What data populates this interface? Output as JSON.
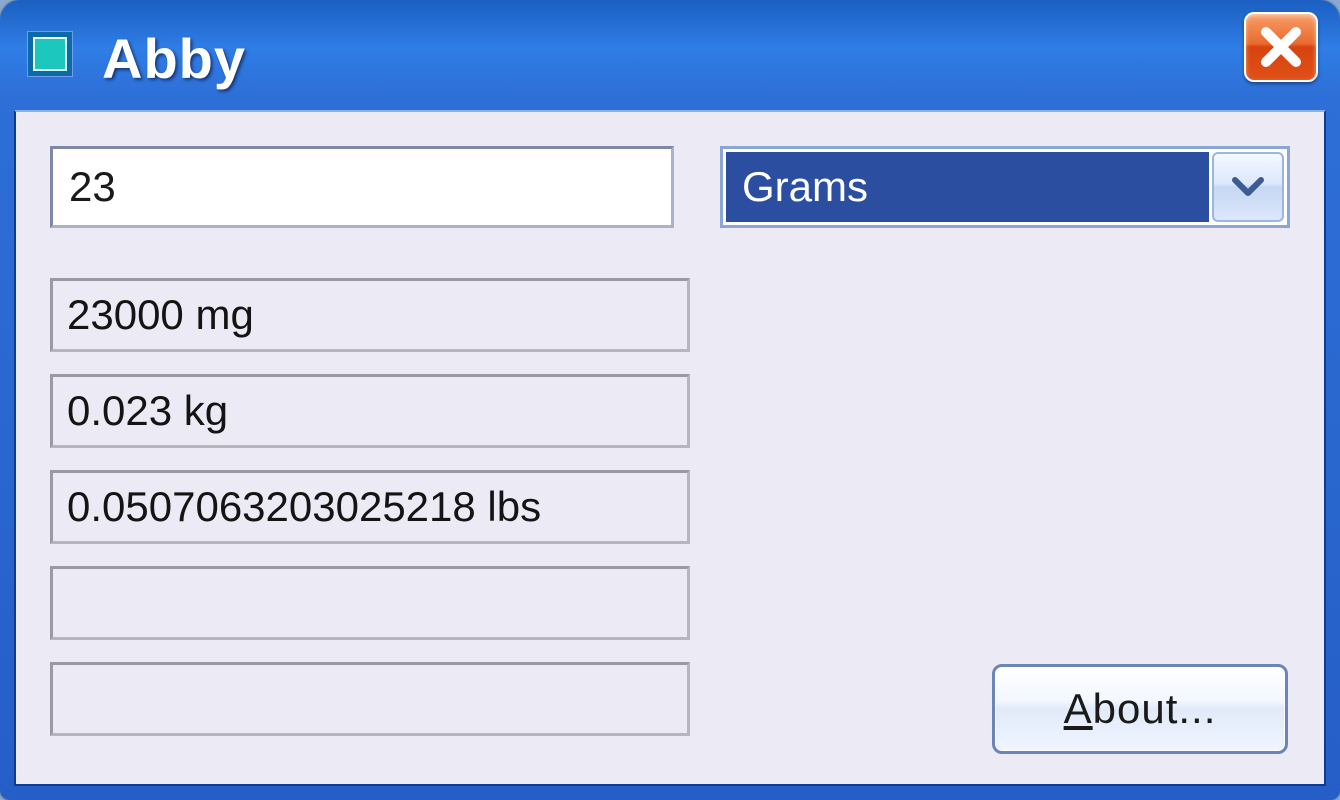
{
  "window": {
    "title": "Abby"
  },
  "input": {
    "value": "23"
  },
  "unit_select": {
    "selected": "Grams"
  },
  "results": {
    "r1": "23000 mg",
    "r2": "0.023 kg",
    "r3": "0.0507063203025218 lbs",
    "r4": "",
    "r5": ""
  },
  "buttons": {
    "about_prefix": "A",
    "about_rest": "bout..."
  }
}
